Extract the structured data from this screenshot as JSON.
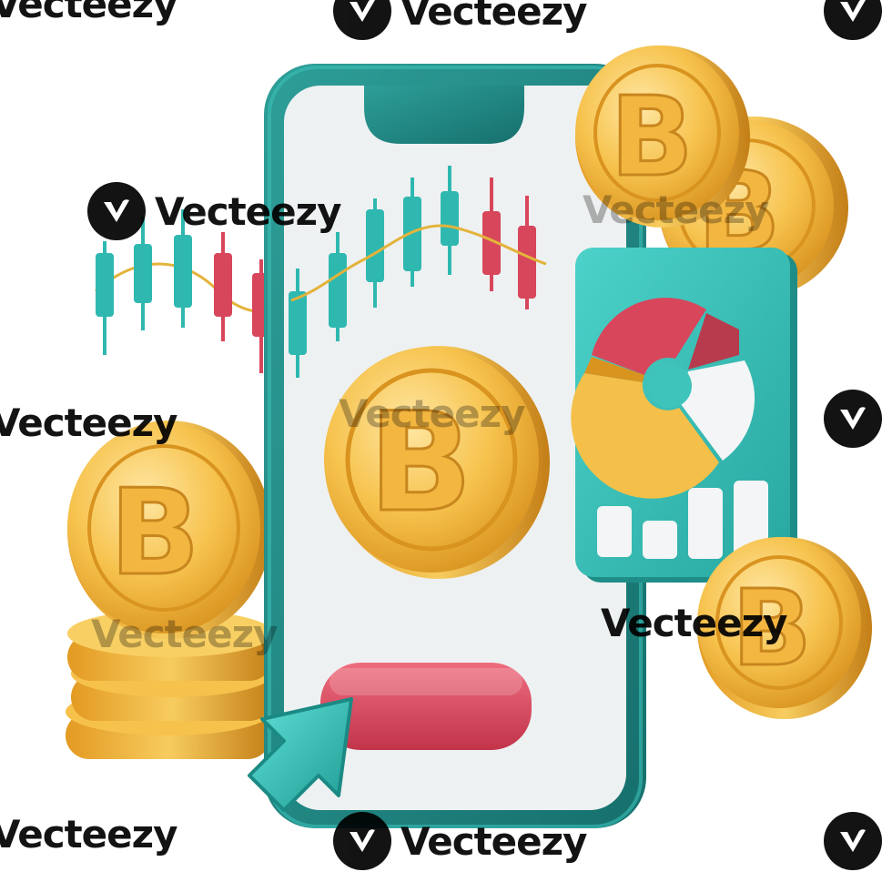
{
  "watermark": {
    "text": "Vecteezy"
  },
  "icons": {
    "logo": "vecteezy-v-logo-icon",
    "coin": "bitcoin-coin-icon",
    "cursor": "arrow-cursor-icon",
    "phone": "smartphone-icon",
    "pie": "donut-chart-icon",
    "bars": "bar-chart-icon",
    "candles": "candlestick-chart-icon"
  },
  "coin_symbol": "B",
  "colors": {
    "teal": "#2fb8b0",
    "teal_dark": "#1a7f7c",
    "red": "#d8465c",
    "gold": "#f2b23b",
    "gold_dark": "#c8861e",
    "screen": "#eef1f2"
  }
}
